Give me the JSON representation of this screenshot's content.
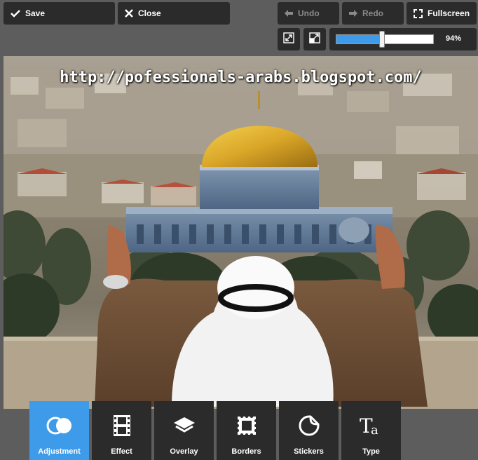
{
  "topbar": {
    "save_label": "Save",
    "close_label": "Close",
    "undo_label": "Undo",
    "redo_label": "Redo",
    "fullscreen_label": "Fullscreen"
  },
  "zoom": {
    "value_text": "94%",
    "level_fraction": 0.47
  },
  "canvas": {
    "watermark_text": "http://pofessionals-arabs.blogspot.com/"
  },
  "tools": [
    {
      "label": "Adjustment",
      "icon": "circles-icon",
      "active": true
    },
    {
      "label": "Effect",
      "icon": "film-icon",
      "active": false
    },
    {
      "label": "Overlay",
      "icon": "layers-icon",
      "active": false
    },
    {
      "label": "Borders",
      "icon": "stamp-border-icon",
      "active": false
    },
    {
      "label": "Stickers",
      "icon": "sticker-icon",
      "active": false
    },
    {
      "label": "Type",
      "icon": "type-icon",
      "active": false
    }
  ],
  "colors": {
    "accent": "#3d9be9",
    "panel": "#2b2b2b",
    "background": "#5d5d5d",
    "dome_gold": "#d9a628"
  }
}
